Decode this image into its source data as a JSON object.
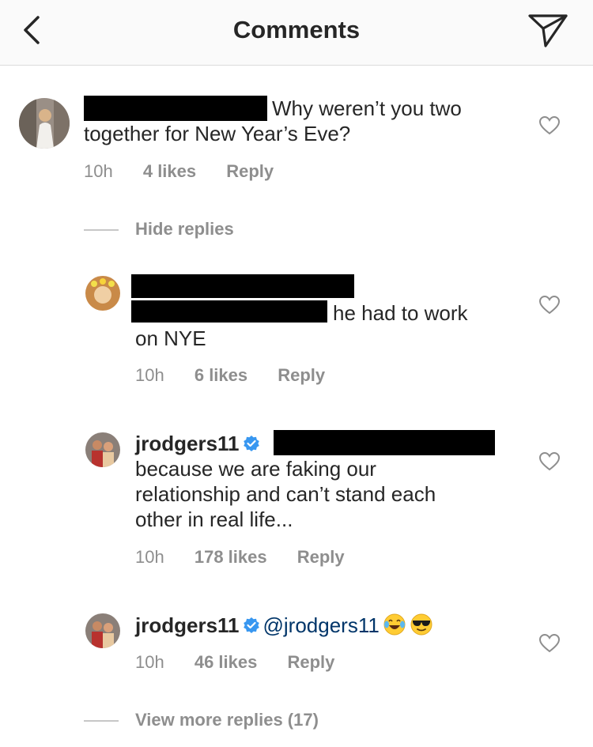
{
  "header": {
    "title": "Comments",
    "back_icon": "chevron-left-icon",
    "send_icon": "paper-plane-icon"
  },
  "comments": [
    {
      "text_line1": "Why weren’t you two",
      "text_line2": "together for New Year’s Eve?",
      "time": "10h",
      "likes": "4 likes",
      "reply": "Reply"
    }
  ],
  "hide_replies": "Hide replies",
  "replies": [
    {
      "text_after_redact": "he had to work",
      "text_line2": "on NYE",
      "time": "10h",
      "likes": "6 likes",
      "reply": "Reply"
    },
    {
      "username": "jrodgers11",
      "text_line1": "because we are faking our",
      "text_line2": "relationship and can’t stand each",
      "text_line3": "other in real life...",
      "time": "10h",
      "likes": "178 likes",
      "reply": "Reply"
    },
    {
      "username": "jrodgers11",
      "mention": "@jrodgers11",
      "emojis": [
        "tears-of-joy-emoji",
        "sunglasses-emoji"
      ],
      "time": "10h",
      "likes": "46 likes",
      "reply": "Reply"
    }
  ],
  "view_more": "View more replies (17)",
  "colors": {
    "text": "#262626",
    "meta": "#8e8e8e",
    "mention": "#003569",
    "verified": "#3897f0",
    "header_bg": "#fafafa"
  }
}
